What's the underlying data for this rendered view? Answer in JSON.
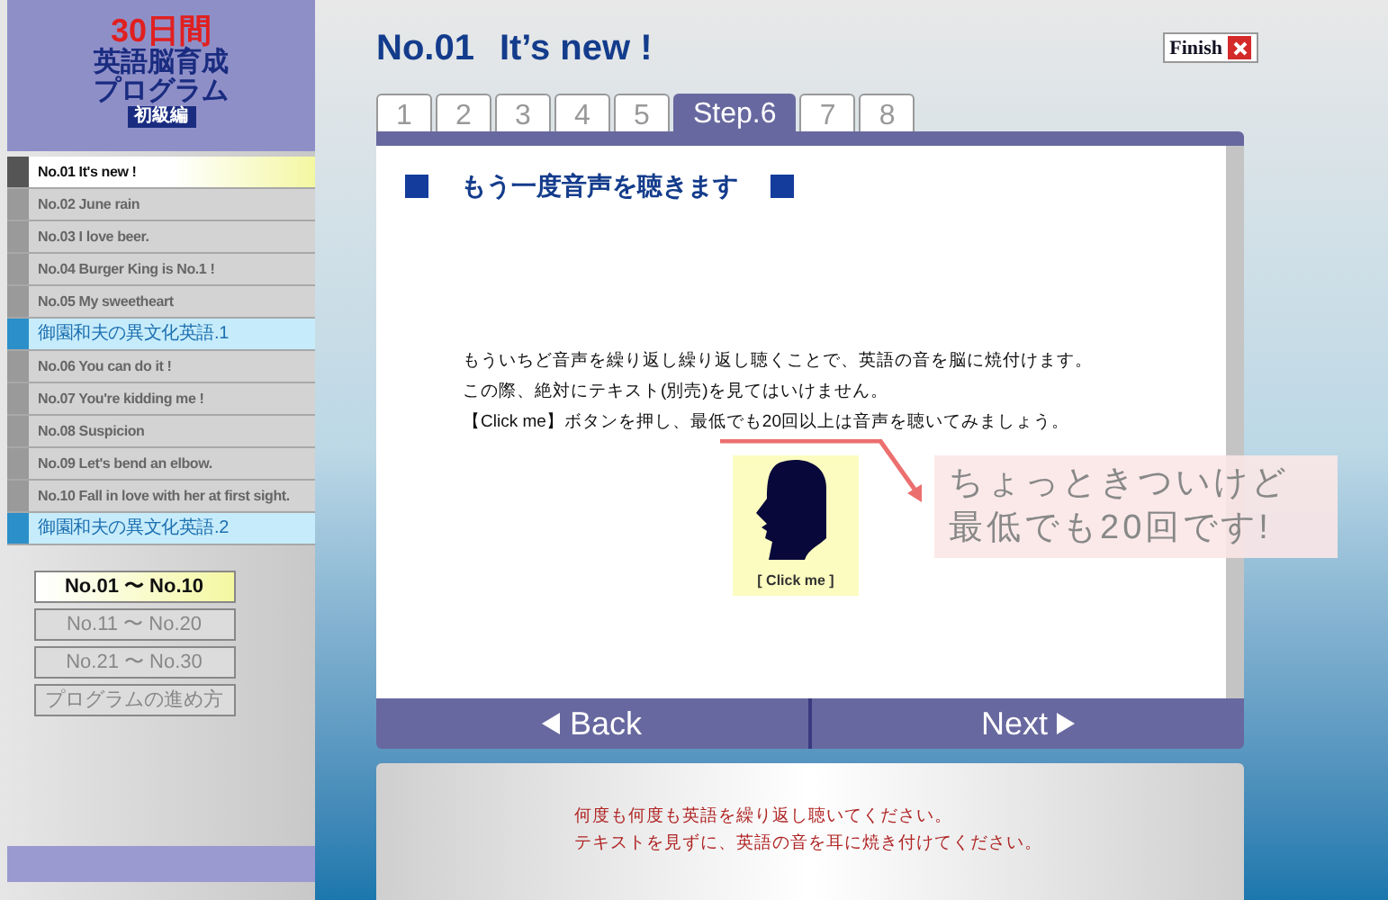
{
  "logo": {
    "days": "30日間",
    "title_line_1": "英語脳育成",
    "title_line_2": "プログラム",
    "level": "初級編"
  },
  "sidebar": {
    "items": [
      {
        "kind": "lesson",
        "label": "No.01 It's new !",
        "selected": true
      },
      {
        "kind": "lesson",
        "label": "No.02 June rain",
        "selected": false
      },
      {
        "kind": "lesson",
        "label": "No.03 I love beer.",
        "selected": false
      },
      {
        "kind": "lesson",
        "label": "No.04 Burger King is No.1 !",
        "selected": false
      },
      {
        "kind": "lesson",
        "label": "No.05 My sweetheart",
        "selected": false
      },
      {
        "kind": "section",
        "label": "御園和夫の異文化英語.1",
        "selected": false
      },
      {
        "kind": "lesson",
        "label": "No.06 You can do it !",
        "selected": false
      },
      {
        "kind": "lesson",
        "label": "No.07 You're kidding me !",
        "selected": false
      },
      {
        "kind": "lesson",
        "label": "No.08 Suspicion",
        "selected": false
      },
      {
        "kind": "lesson",
        "label": "No.09 Let's bend an elbow.",
        "selected": false
      },
      {
        "kind": "lesson",
        "label": "No.10 Fall in love with her at first sight.",
        "selected": false
      },
      {
        "kind": "section",
        "label": "御園和夫の異文化英語.2",
        "selected": false
      }
    ],
    "ranges": [
      {
        "label": "No.01 〜 No.10",
        "selected": true
      },
      {
        "label": "No.11 〜 No.20",
        "selected": false
      },
      {
        "label": "No.21 〜 No.30",
        "selected": false
      },
      {
        "label": "プログラムの進め方",
        "selected": false
      }
    ]
  },
  "header": {
    "number": "No.01",
    "title": "It’s new !",
    "finish": "Finish"
  },
  "tabs": [
    {
      "label": "1",
      "selected": false
    },
    {
      "label": "2",
      "selected": false
    },
    {
      "label": "3",
      "selected": false
    },
    {
      "label": "4",
      "selected": false
    },
    {
      "label": "5",
      "selected": false
    },
    {
      "label": "Step.6",
      "selected": true
    },
    {
      "label": "7",
      "selected": false
    },
    {
      "label": "8",
      "selected": false
    }
  ],
  "content": {
    "heading": "もう一度音声を聴きます",
    "lines": [
      "もういちど音声を繰り返し繰り返し聴くことで、英語の音を脳に焼付けます。",
      "この際、絶対にテキスト(別売)を見てはいけません。",
      "【Click me】ボタンを押し、最低でも20回以上は音声を聴いてみましょう。"
    ],
    "click_label": "[ Click me ]"
  },
  "annotation": {
    "line_1": "ちょっときついけど",
    "line_2": "最低でも20回です!"
  },
  "nav": {
    "back": "Back",
    "next": "Next"
  },
  "notice": [
    "何度も何度も英語を繰り返し聴いてください。",
    "テキストを見ずに、英語の音を耳に焼き付けてください。"
  ]
}
